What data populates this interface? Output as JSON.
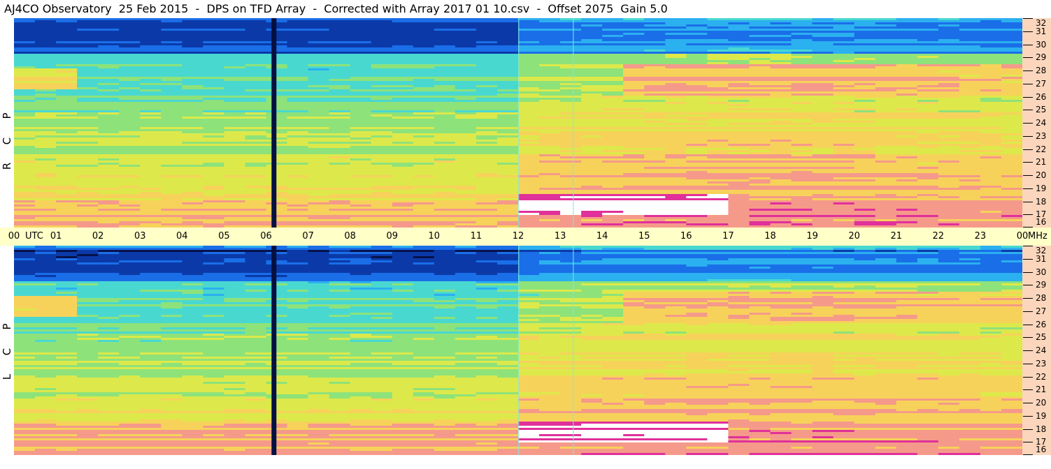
{
  "header": {
    "title": "AJ4CO Observatory  25 Feb 2015  -  DPS on TFD Array  -  Corrected with Array 2017 01 10.csv  -  Offset 2075  Gain 5.0"
  },
  "chart_data": {
    "type": "heatmap",
    "title": "AJ4CO Observatory  25 Feb 2015  -  DPS on TFD Array  -  Corrected with Array 2017 01 10.csv  -  Offset 2075  Gain 5.0",
    "x_tick_labels": [
      "00",
      "01",
      "02",
      "03",
      "04",
      "05",
      "06",
      "07",
      "08",
      "09",
      "10",
      "11",
      "12",
      "13",
      "14",
      "15",
      "16",
      "17",
      "18",
      "19",
      "20",
      "21",
      "22",
      "23",
      "00"
    ],
    "x_unit_label": "UTC",
    "y_unit_label": "MHz",
    "y_tick_labels": [
      "32",
      "31",
      "30",
      "29",
      "28",
      "27",
      "26",
      "25",
      "24",
      "23",
      "22",
      "21",
      "20",
      "19",
      "18",
      "17",
      "16"
    ],
    "xlim": [
      0,
      24
    ],
    "ylim": [
      16,
      32
    ],
    "colormap": [
      "#06124a",
      "#0b3aa8",
      "#1a6ee8",
      "#2bb0f0",
      "#49d8d0",
      "#8ee27a",
      "#dde94a",
      "#f7d25a",
      "#f59a8a",
      "#e0309a",
      "#ffffff"
    ],
    "panels": [
      {
        "name": "RCP",
        "label": [
          "R",
          "C",
          "P"
        ],
        "dropouts": [
          {
            "t": 6.18,
            "from": 16,
            "to": 32
          }
        ]
      },
      {
        "name": "LCP",
        "label": [
          "L",
          "C",
          "P"
        ],
        "dropouts": [
          {
            "t": 6.18,
            "from": 16,
            "to": 32
          }
        ]
      }
    ],
    "interference_lines": [
      {
        "t": 12.0
      },
      {
        "t": 13.3
      }
    ]
  }
}
